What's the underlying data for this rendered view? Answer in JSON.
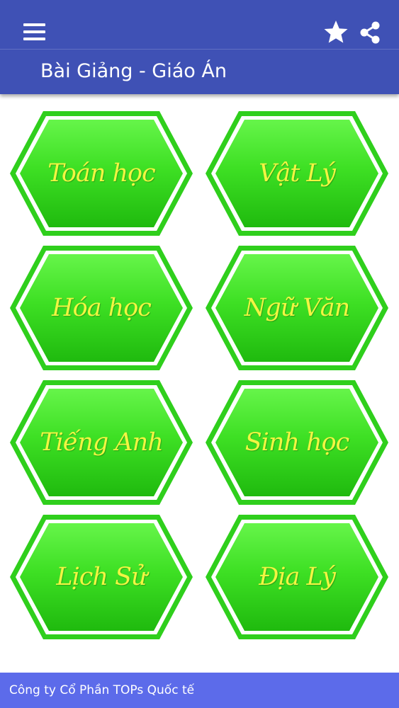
{
  "header": {
    "title": "Bài Giảng - Giáo Án",
    "menu_icon": "hamburger-menu-icon",
    "favorite_icon": "star-icon",
    "share_icon": "share-icon"
  },
  "subjects": [
    {
      "label": "Toán học"
    },
    {
      "label": "Vật Lý"
    },
    {
      "label": "Hóa học"
    },
    {
      "label": "Ngữ Văn"
    },
    {
      "label": "Tiếng Anh"
    },
    {
      "label": "Sinh học"
    },
    {
      "label": "Lịch Sử"
    },
    {
      "label": "Địa Lý"
    }
  ],
  "footer": {
    "text": "Công ty Cổ Phần TOPs Quốc tế"
  },
  "colors": {
    "appbar": "#3f51b5",
    "footer": "#5c6bea",
    "tile_green": "#2fcf1c",
    "tile_text": "#f2f542"
  }
}
